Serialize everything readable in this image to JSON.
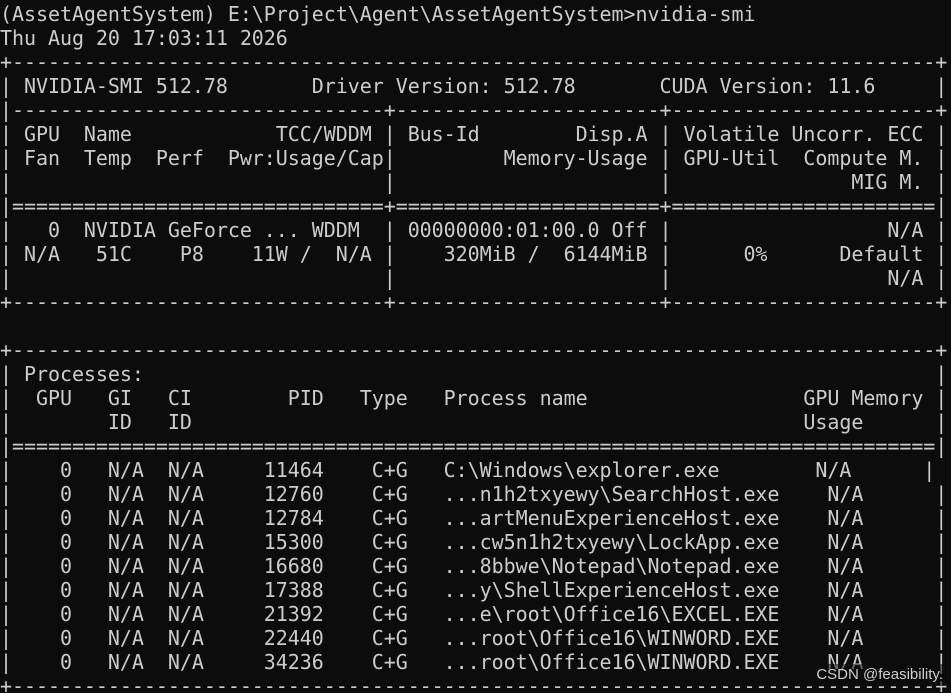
{
  "terminal": {
    "lines": [
      "(AssetAgentSystem) E:\\Project\\Agent\\AssetAgentSystem>nvidia-smi",
      "Thu Aug 20 17:03:11 2026",
      "+-----------------------------------------------------------------------------+",
      "| NVIDIA-SMI 512.78       Driver Version: 512.78       CUDA Version: 11.6     |",
      "|-------------------------------+----------------------+----------------------+",
      "| GPU  Name            TCC/WDDM | Bus-Id        Disp.A | Volatile Uncorr. ECC |",
      "| Fan  Temp  Perf  Pwr:Usage/Cap|         Memory-Usage | GPU-Util  Compute M. |",
      "|                               |                      |               MIG M. |",
      "|===============================+======================+======================|",
      "|   0  NVIDIA GeForce ... WDDM  | 00000000:01:00.0 Off |                  N/A |",
      "| N/A   51C    P8    11W /  N/A |    320MiB /  6144MiB |      0%      Default |",
      "|                               |                      |                  N/A |",
      "+-------------------------------+----------------------+----------------------+",
      "",
      "+-----------------------------------------------------------------------------+",
      "| Processes:                                                                  |",
      "|  GPU   GI   CI        PID   Type   Process name                  GPU Memory |",
      "|        ID   ID                                                   Usage      |",
      "|=============================================================================|",
      "|    0   N/A  N/A     11464    C+G   C:\\Windows\\explorer.exe        N/A      |",
      "|    0   N/A  N/A     12760    C+G   ...n1h2txyewy\\SearchHost.exe    N/A      |",
      "|    0   N/A  N/A     12784    C+G   ...artMenuExperienceHost.exe    N/A      |",
      "|    0   N/A  N/A     15300    C+G   ...cw5n1h2txyewy\\LockApp.exe    N/A      |",
      "|    0   N/A  N/A     16680    C+G   ...8bbwe\\Notepad\\Notepad.exe    N/A      |",
      "|    0   N/A  N/A     17388    C+G   ...y\\ShellExperienceHost.exe    N/A      |",
      "|    0   N/A  N/A     21392    C+G   ...e\\root\\Office16\\EXCEL.EXE    N/A      |",
      "|    0   N/A  N/A     22440    C+G   ...root\\Office16\\WINWORD.EXE    N/A      |",
      "|    0   N/A  N/A     34236    C+G   ...root\\Office16\\WINWORD.EXE    N/A      |",
      "+-----------------------------------------------------------------------------+"
    ]
  },
  "watermark": "CSDN @feasibility."
}
